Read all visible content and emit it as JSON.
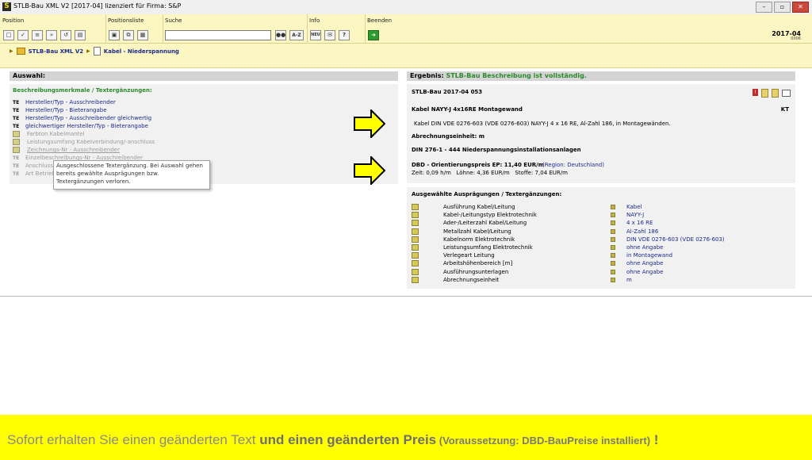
{
  "window": {
    "title": "STLB-Bau XML V2 [2017-04] lizenziert für Firma: S&P",
    "app_icon": "S"
  },
  "toolbar": {
    "groups": {
      "position": "Position",
      "positionsliste": "Positionsliste",
      "suche": "Suche",
      "info": "Info",
      "beenden": "Beenden"
    },
    "search_button_label": "A-Z",
    "info_new_label": "NEU",
    "help_label": "?",
    "version_year": "2017-04",
    "version_sub": "0006"
  },
  "breadcrumb": {
    "root": "STLB-Bau XML V2",
    "current": "Kabel - Niederspannung"
  },
  "auswahl": {
    "heading": "Auswahl:",
    "section_title": "Beschreibungsmerkmale / Textergänzungen:",
    "items": [
      {
        "badge": "TE",
        "label": "Hersteller/Typ - Ausschreibender",
        "state": "active"
      },
      {
        "badge": "TE",
        "label": "Hersteller/Typ - Bieterangabe",
        "state": "active"
      },
      {
        "badge": "TE",
        "label": "Hersteller/Typ - Ausschreibender gleichwertig",
        "state": "active"
      },
      {
        "badge": "TE",
        "label": "gleichwertiger Hersteller/Typ - Bieterangabe",
        "state": "active"
      },
      {
        "badge": "",
        "label": "Farbton Kabelmantel",
        "state": "disabled"
      },
      {
        "badge": "",
        "label": "Leistungsumfang Kabelverbindung/-anschluss",
        "state": "disabled"
      },
      {
        "badge": "",
        "label": "Zeichnungs-Nr - Ausschreibender",
        "state": "disabled"
      },
      {
        "badge": "TE",
        "label": "Einzelbeschreibungs-Nr - Ausschreibender",
        "state": "disabled"
      },
      {
        "badge": "TE",
        "label": "Anschlussart",
        "state": "disabled"
      },
      {
        "badge": "TE",
        "label": "Art Betrieb",
        "state": "disabled"
      }
    ],
    "tooltip": "Ausgeschlossene Textergänzung. Bei Auswahl gehen bereits gewählte Ausprägungen bzw. Textergänzungen verloren."
  },
  "ergebnis": {
    "heading_label": "Ergebnis:",
    "heading_status": "STLB-Bau Beschreibung ist vollständig.",
    "stlb_id": "STLB-Bau 2017-04 053",
    "short_text": "Kabel NAYY-J 4x16RE Montagewand",
    "unit_code": "KT",
    "long_text": "Kabel DIN VDE 0276-603 (VDE 0276-603) NAYY-J 4 x 16 RE, Al-Zahl 186, in Montagewänden.",
    "abrechnungseinheit": "Abrechnungseinheit: m",
    "din": "DIN 276-1 - 444 Niederspannungsinstallationsanlagen",
    "price_line": "DBD - Orientierungspreis EP: 11,40 EUR/m",
    "region": "(Region: Deutschland)",
    "detail_line": "Zeit: 0,09 h/m   Löhne: 4,36 EUR/m   Stoffe: 7,04 EUR/m"
  },
  "auspraegungen": {
    "title": "Ausgewählte Ausprägungen / Textergänzungen:",
    "rows": [
      {
        "name": "Ausführung Kabel/Leitung",
        "value": "Kabel"
      },
      {
        "name": "Kabel-/Leitungstyp Elektrotechnik",
        "value": "NAYY-J"
      },
      {
        "name": "Ader-/Leiterzahl Kabel/Leitung",
        "value": "4 x 16 RE"
      },
      {
        "name": "Metallzahl Kabel/Leitung",
        "value": "Al-Zahl 186"
      },
      {
        "name": "Kabelnorm Elektrotechnik",
        "value": "DIN VDE 0276-603 (VDE 0276-603)"
      },
      {
        "name": "Leistungsumfang Elektrotechnik",
        "value": "ohne Angabe"
      },
      {
        "name": "Verlegeart Leitung",
        "value": "in Montagewand"
      },
      {
        "name": "Arbeitshöhenbereich [m]",
        "value": "ohne Angabe"
      },
      {
        "name": "Ausführungsunterlagen",
        "value": "ohne Angabe"
      },
      {
        "name": "Abrechnungseinheit",
        "value": "m"
      }
    ]
  },
  "banner": {
    "part1": "Sofort erhalten Sie einen geänderten Text ",
    "part2": "und einen geänderten Preis",
    "part3": " (Voraussetzung: DBD-BauPreise installiert)",
    "part4": " !"
  },
  "colors": {
    "toolbar_bg": "#fbf6c2",
    "banner_bg": "#ffff00",
    "link_blue": "#1b2a8c",
    "ok_green": "#2b8a2b",
    "arrow_yellow": "#ffff00"
  }
}
